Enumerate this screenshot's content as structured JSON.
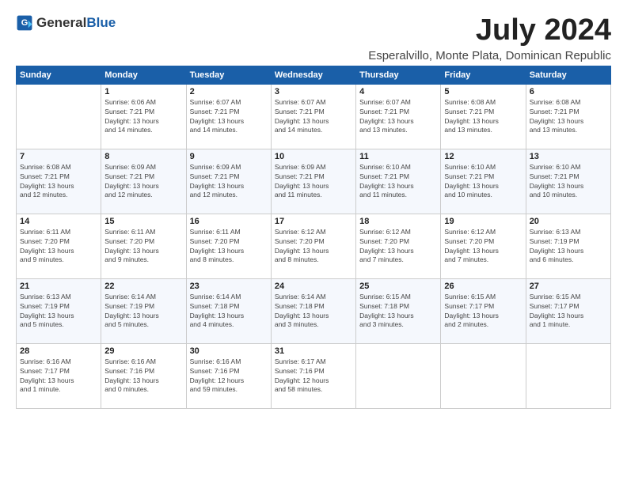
{
  "header": {
    "logo_general": "General",
    "logo_blue": "Blue",
    "title": "July 2024",
    "location": "Esperalvillo, Monte Plata, Dominican Republic"
  },
  "days_of_week": [
    "Sunday",
    "Monday",
    "Tuesday",
    "Wednesday",
    "Thursday",
    "Friday",
    "Saturday"
  ],
  "weeks": [
    [
      {
        "day": "",
        "info": ""
      },
      {
        "day": "1",
        "info": "Sunrise: 6:06 AM\nSunset: 7:21 PM\nDaylight: 13 hours\nand 14 minutes."
      },
      {
        "day": "2",
        "info": "Sunrise: 6:07 AM\nSunset: 7:21 PM\nDaylight: 13 hours\nand 14 minutes."
      },
      {
        "day": "3",
        "info": "Sunrise: 6:07 AM\nSunset: 7:21 PM\nDaylight: 13 hours\nand 14 minutes."
      },
      {
        "day": "4",
        "info": "Sunrise: 6:07 AM\nSunset: 7:21 PM\nDaylight: 13 hours\nand 13 minutes."
      },
      {
        "day": "5",
        "info": "Sunrise: 6:08 AM\nSunset: 7:21 PM\nDaylight: 13 hours\nand 13 minutes."
      },
      {
        "day": "6",
        "info": "Sunrise: 6:08 AM\nSunset: 7:21 PM\nDaylight: 13 hours\nand 13 minutes."
      }
    ],
    [
      {
        "day": "7",
        "info": "Sunrise: 6:08 AM\nSunset: 7:21 PM\nDaylight: 13 hours\nand 12 minutes."
      },
      {
        "day": "8",
        "info": "Sunrise: 6:09 AM\nSunset: 7:21 PM\nDaylight: 13 hours\nand 12 minutes."
      },
      {
        "day": "9",
        "info": "Sunrise: 6:09 AM\nSunset: 7:21 PM\nDaylight: 13 hours\nand 12 minutes."
      },
      {
        "day": "10",
        "info": "Sunrise: 6:09 AM\nSunset: 7:21 PM\nDaylight: 13 hours\nand 11 minutes."
      },
      {
        "day": "11",
        "info": "Sunrise: 6:10 AM\nSunset: 7:21 PM\nDaylight: 13 hours\nand 11 minutes."
      },
      {
        "day": "12",
        "info": "Sunrise: 6:10 AM\nSunset: 7:21 PM\nDaylight: 13 hours\nand 10 minutes."
      },
      {
        "day": "13",
        "info": "Sunrise: 6:10 AM\nSunset: 7:21 PM\nDaylight: 13 hours\nand 10 minutes."
      }
    ],
    [
      {
        "day": "14",
        "info": "Sunrise: 6:11 AM\nSunset: 7:20 PM\nDaylight: 13 hours\nand 9 minutes."
      },
      {
        "day": "15",
        "info": "Sunrise: 6:11 AM\nSunset: 7:20 PM\nDaylight: 13 hours\nand 9 minutes."
      },
      {
        "day": "16",
        "info": "Sunrise: 6:11 AM\nSunset: 7:20 PM\nDaylight: 13 hours\nand 8 minutes."
      },
      {
        "day": "17",
        "info": "Sunrise: 6:12 AM\nSunset: 7:20 PM\nDaylight: 13 hours\nand 8 minutes."
      },
      {
        "day": "18",
        "info": "Sunrise: 6:12 AM\nSunset: 7:20 PM\nDaylight: 13 hours\nand 7 minutes."
      },
      {
        "day": "19",
        "info": "Sunrise: 6:12 AM\nSunset: 7:20 PM\nDaylight: 13 hours\nand 7 minutes."
      },
      {
        "day": "20",
        "info": "Sunrise: 6:13 AM\nSunset: 7:19 PM\nDaylight: 13 hours\nand 6 minutes."
      }
    ],
    [
      {
        "day": "21",
        "info": "Sunrise: 6:13 AM\nSunset: 7:19 PM\nDaylight: 13 hours\nand 5 minutes."
      },
      {
        "day": "22",
        "info": "Sunrise: 6:14 AM\nSunset: 7:19 PM\nDaylight: 13 hours\nand 5 minutes."
      },
      {
        "day": "23",
        "info": "Sunrise: 6:14 AM\nSunset: 7:18 PM\nDaylight: 13 hours\nand 4 minutes."
      },
      {
        "day": "24",
        "info": "Sunrise: 6:14 AM\nSunset: 7:18 PM\nDaylight: 13 hours\nand 3 minutes."
      },
      {
        "day": "25",
        "info": "Sunrise: 6:15 AM\nSunset: 7:18 PM\nDaylight: 13 hours\nand 3 minutes."
      },
      {
        "day": "26",
        "info": "Sunrise: 6:15 AM\nSunset: 7:17 PM\nDaylight: 13 hours\nand 2 minutes."
      },
      {
        "day": "27",
        "info": "Sunrise: 6:15 AM\nSunset: 7:17 PM\nDaylight: 13 hours\nand 1 minute."
      }
    ],
    [
      {
        "day": "28",
        "info": "Sunrise: 6:16 AM\nSunset: 7:17 PM\nDaylight: 13 hours\nand 1 minute."
      },
      {
        "day": "29",
        "info": "Sunrise: 6:16 AM\nSunset: 7:16 PM\nDaylight: 13 hours\nand 0 minutes."
      },
      {
        "day": "30",
        "info": "Sunrise: 6:16 AM\nSunset: 7:16 PM\nDaylight: 12 hours\nand 59 minutes."
      },
      {
        "day": "31",
        "info": "Sunrise: 6:17 AM\nSunset: 7:16 PM\nDaylight: 12 hours\nand 58 minutes."
      },
      {
        "day": "",
        "info": ""
      },
      {
        "day": "",
        "info": ""
      },
      {
        "day": "",
        "info": ""
      }
    ]
  ]
}
